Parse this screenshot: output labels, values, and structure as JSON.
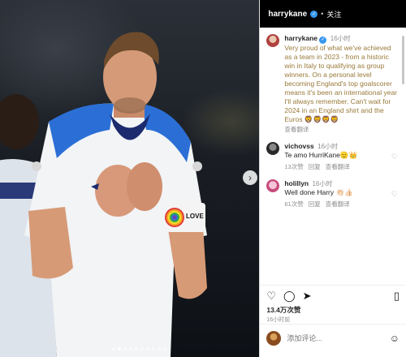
{
  "post": {
    "username": "harrykane",
    "follow_label": "关注",
    "separator": "•"
  },
  "caption": {
    "username": "harrykane",
    "time": "16小时",
    "text": "Very proud of what we've achieved as a team in 2023 - from a historic win in Italy to qualifying as group winners. On a personal level becoming England's top goalscorer means it's been an international year I'll always remember. Can't wait for 2024 in an England shirt and the Euros 🦁🦁🦁🦁",
    "translate_label": "查看翻译"
  },
  "comments": [
    {
      "username": "vichovss",
      "time": "16小时",
      "text": "Te amo HurriKane🫡👑",
      "likes": "13次赞",
      "reply_label": "回复",
      "translate_label": "查看翻译"
    },
    {
      "username": "holillyn",
      "time": "16小时",
      "text": "Well done Harry 👏🏻👍🏻",
      "likes": "61次赞",
      "reply_label": "回复",
      "translate_label": "查看翻译"
    }
  ],
  "stats": {
    "likes": "13.4万次赞",
    "date": "16小时前"
  },
  "add_comment": {
    "placeholder": "添加评论..."
  },
  "photo": {
    "sleeve_text": "LOVE",
    "next_arrow": "›",
    "carousel_dots": 10,
    "active_dot": 1
  },
  "icons": {
    "verified": "verified-badge-icon",
    "heart": "heart-icon",
    "comment": "comment-icon",
    "share": "share-icon",
    "bookmark": "bookmark-icon",
    "emoji": "emoji-icon"
  },
  "colors": {
    "verified": "#3897f0",
    "panel_bg": "#ffffff",
    "text_secondary": "#8e8e8e"
  }
}
